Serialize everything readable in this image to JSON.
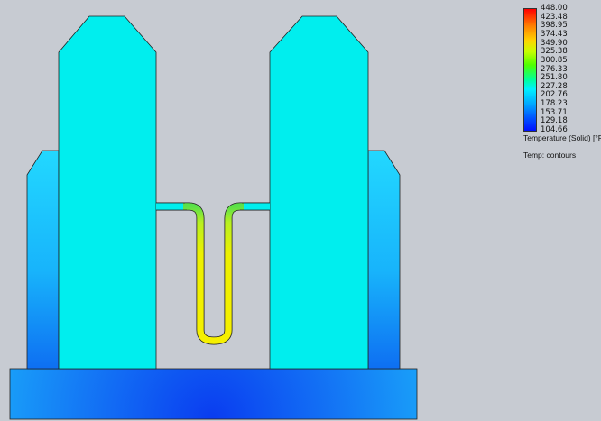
{
  "legend": {
    "ticks": [
      "448.00",
      "423.48",
      "398.95",
      "374.43",
      "349.90",
      "325.38",
      "300.85",
      "276.33",
      "251.80",
      "227.28",
      "202.76",
      "178.23",
      "153.71",
      "129.18",
      "104.66"
    ],
    "quantity": "Temperature (Solid) [°F]",
    "plot_type": "Temp: contours"
  },
  "colors": {
    "background": "#c7cbd2",
    "solid_mid": "#00eeee",
    "hot": "#f0f000",
    "warm": "#40e040",
    "cool": "#0a4cf0"
  }
}
